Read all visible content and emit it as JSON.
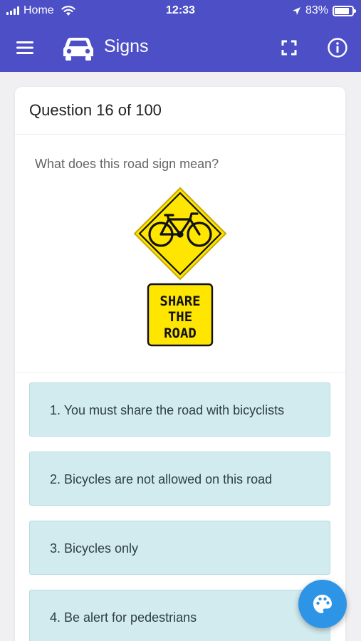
{
  "status_bar": {
    "carrier": "Home",
    "time": "12:33",
    "battery": "83%",
    "battery_level": 0.83
  },
  "toolbar": {
    "title": "Signs",
    "icons": [
      "menu-icon",
      "car-icon",
      "fullscreen-icon",
      "info-icon"
    ]
  },
  "quiz": {
    "header": "Question 16 of 100",
    "question": "What does this road sign mean?",
    "sign_text": [
      "SHARE",
      "THE",
      "ROAD"
    ],
    "answers": [
      "1. You must share the road with bicyclists",
      "2. Bicycles are not allowed on this road",
      "3. Bicycles only",
      "4. Be alert for pedestrians"
    ]
  },
  "colors": {
    "header": "#4d4fc7",
    "answer_bg": "#d2ebef",
    "sign_yellow": "#ffe600",
    "fab": "#2e95e6"
  }
}
